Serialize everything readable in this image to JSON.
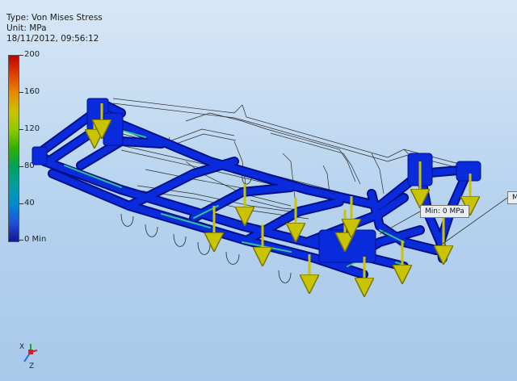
{
  "header": {
    "type_line": "Type: Von Mises Stress",
    "unit_line": "Unit: MPa",
    "date_line": "18/11/2012, 09:56:12"
  },
  "legend": {
    "labels": [
      "200",
      "160",
      "120",
      "80",
      "40",
      "0 Min"
    ]
  },
  "probes": {
    "min_label": "Min: 0 MPa",
    "max_label": "Ma"
  },
  "triad": {
    "x_label": "X",
    "z_label": "Z"
  },
  "colors": {
    "frame_blue": "#0a2bdc",
    "frame_edge": "#00108a",
    "stress_green": "#33e08a",
    "arrow_yellow": "#c9c400"
  }
}
